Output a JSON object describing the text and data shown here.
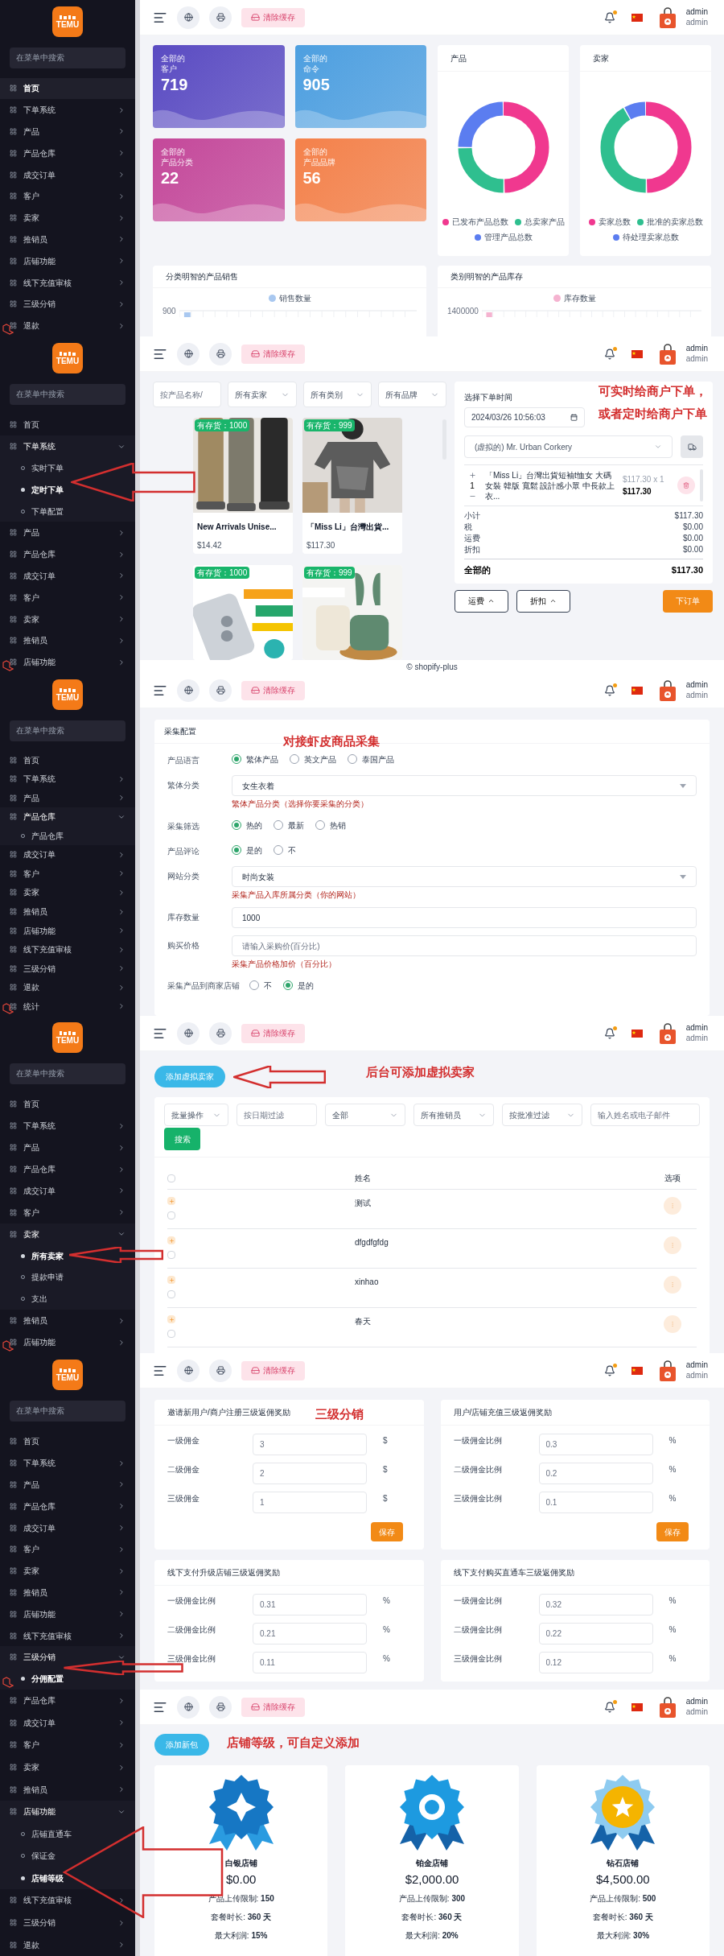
{
  "panels": [
    {
      "kind": "dashboard",
      "sidebar": {
        "logo": "TEMU",
        "search_placeholder": "在菜单中搜索",
        "items": [
          {
            "label": "首页",
            "selected": true
          },
          {
            "label": "下单系统",
            "selected": false,
            "expanded": false
          },
          {
            "label": "产品",
            "selected": false,
            "expanded": false
          },
          {
            "label": "产品仓库",
            "selected": false,
            "expanded": false
          },
          {
            "label": "成交订单",
            "selected": false,
            "expanded": false
          },
          {
            "label": "客户",
            "selected": false,
            "expanded": false
          },
          {
            "label": "卖家",
            "selected": false,
            "expanded": false
          },
          {
            "label": "推销员",
            "selected": false,
            "expanded": false
          },
          {
            "label": "店铺功能",
            "selected": false,
            "expanded": false
          },
          {
            "label": "线下充值审核",
            "selected": false,
            "expanded": false
          },
          {
            "label": "三级分销",
            "selected": false,
            "expanded": false
          },
          {
            "label": "退款",
            "selected": false,
            "expanded": false
          }
        ]
      },
      "header": {
        "clear_cache": "清除缓存",
        "unread": true,
        "user": "admin",
        "role": "admin"
      },
      "stats": [
        {
          "label": "全部的",
          "sublabel": "客户",
          "value": "719",
          "color": "#5a4bc2"
        },
        {
          "label": "全部的",
          "sublabel": "命令",
          "value": "905",
          "color": "#4d9fe0"
        },
        {
          "label": "全部的",
          "sublabel": "产品分类",
          "value": "22",
          "color": "#c4489a"
        },
        {
          "label": "全部的",
          "sublabel": "产品品牌",
          "value": "56",
          "color": "#f4814a"
        }
      ],
      "donuts": [
        {
          "title": "产品",
          "legend": [
            {
              "label": "已发布产品总数",
              "color": "#f0388f"
            },
            {
              "label": "总卖家产品",
              "color": "#2fbf8f"
            },
            {
              "label": "管理产品总数",
              "color": "#5b7df0"
            }
          ]
        },
        {
          "title": "卖家",
          "legend": [
            {
              "label": "卖家总数",
              "color": "#f0388f"
            },
            {
              "label": "批准的卖家总数",
              "color": "#2fbf8f"
            },
            {
              "label": "待处理卖家总数",
              "color": "#5b7df0"
            }
          ]
        }
      ],
      "bar_charts": [
        {
          "title": "分类明智的产品销售",
          "legend": {
            "label": "销售数量",
            "color": "#a9c8f0"
          },
          "y_tick": "900"
        },
        {
          "title": "类别明智的产品库存",
          "legend": {
            "label": "库存数量",
            "color": "#f5b3d0"
          },
          "y_tick": "1400000"
        }
      ]
    },
    {
      "kind": "order",
      "sidebar": {
        "logo": "TEMU",
        "search_placeholder": "在菜单中搜索",
        "items": [
          {
            "label": "首页",
            "selected": false
          },
          {
            "label": "下单系统",
            "selected": false,
            "expanded": true,
            "children": [
              {
                "label": "实时下单",
                "selected": false
              },
              {
                "label": "定时下单",
                "selected": true
              },
              {
                "label": "下单配置",
                "selected": false
              }
            ]
          },
          {
            "label": "产品",
            "selected": false,
            "expanded": false
          },
          {
            "label": "产品仓库",
            "selected": false,
            "expanded": false
          },
          {
            "label": "成交订单",
            "selected": false,
            "expanded": false
          },
          {
            "label": "客户",
            "selected": false,
            "expanded": false
          },
          {
            "label": "卖家",
            "selected": false,
            "expanded": false
          },
          {
            "label": "推销员",
            "selected": false,
            "expanded": false
          },
          {
            "label": "店铺功能",
            "selected": false,
            "expanded": false
          }
        ]
      },
      "header": {
        "clear_cache": "清除缓存",
        "unread": true,
        "user": "admin",
        "role": "admin"
      },
      "annotations": [
        "可实时给商户下单，",
        "或者定时给商户下单"
      ],
      "filters": [
        {
          "kind": "input",
          "placeholder": "按产品名称/"
        },
        {
          "kind": "select",
          "value": "所有卖家"
        },
        {
          "kind": "select",
          "value": "所有类别"
        },
        {
          "kind": "select",
          "value": "所有品牌"
        }
      ],
      "products": [
        {
          "stock": "有存货：1000",
          "name": "New Arrivals Unise...",
          "price": "$14.42"
        },
        {
          "stock": "有存货：999",
          "name": "「Miss Li」台灣出貨...",
          "price": "$117.30"
        },
        {
          "stock": "有存货：1000"
        },
        {
          "stock": "有存货：999"
        }
      ],
      "order": {
        "time_label": "选择下单时间",
        "time": "2024/03/26 10:56:03",
        "customer": "(虚拟的) Mr. Urban Corkery",
        "cart": [
          {
            "qty": "1",
            "name": "「Miss Li」台灣出貨短袖t恤女 大碼女裝 韓版 寬鬆 設計感小眾 中長款上衣...",
            "unit": "$117.30 x 1",
            "price": "$117.30"
          }
        ],
        "summary": [
          {
            "label": "小计",
            "value": "$117.30"
          },
          {
            "label": "税",
            "value": "$0.00"
          },
          {
            "label": "运费",
            "value": "$0.00"
          },
          {
            "label": "折扣",
            "value": "$0.00"
          }
        ],
        "total": {
          "label": "全部的",
          "value": "$117.30"
        }
      },
      "buttons": [
        {
          "kind": "toggle",
          "label": "运费"
        },
        {
          "kind": "toggle",
          "label": "折扣"
        },
        {
          "kind": "primary",
          "label": "下订单"
        }
      ],
      "footer": "© shopify-plus"
    },
    {
      "kind": "collect_form",
      "sidebar": {
        "logo": "TEMU",
        "search_placeholder": "在菜单中搜索",
        "items": [
          {
            "label": "首页",
            "selected": false
          },
          {
            "label": "下单系统",
            "selected": false,
            "expanded": false
          },
          {
            "label": "产品",
            "selected": false,
            "expanded": false
          },
          {
            "label": "产品仓库",
            "selected": false,
            "expanded": true,
            "children": [
              {
                "label": "产品仓库",
                "selected": false
              }
            ]
          },
          {
            "label": "成交订单",
            "selected": false,
            "expanded": false
          },
          {
            "label": "客户",
            "selected": false,
            "expanded": false
          },
          {
            "label": "卖家",
            "selected": false,
            "expanded": false
          },
          {
            "label": "推销员",
            "selected": false,
            "expanded": false
          },
          {
            "label": "店铺功能",
            "selected": false,
            "expanded": false
          },
          {
            "label": "线下充值审核",
            "selected": false,
            "expanded": false
          },
          {
            "label": "三级分销",
            "selected": false,
            "expanded": false
          },
          {
            "label": "退款",
            "selected": false,
            "expanded": false
          },
          {
            "label": "统计",
            "selected": false,
            "expanded": false
          }
        ]
      },
      "header": {
        "clear_cache": "清除缓存",
        "unread": true,
        "user": "admin",
        "role": "admin"
      },
      "annotations": [
        "对接虾皮商品采集"
      ],
      "card_title": "采集配置",
      "rows": [
        {
          "kind": "radio",
          "label": "产品语言",
          "options": [
            {
              "label": "繁体产品",
              "selected": true
            },
            {
              "label": "英文产品",
              "selected": false
            },
            {
              "label": "泰国产品",
              "selected": false
            }
          ]
        },
        {
          "kind": "select",
          "label": "繁体分类",
          "value": "女生衣着",
          "hint": "繁体产品分类（选择你要采集的分类）"
        },
        {
          "kind": "radio",
          "label": "采集筛选",
          "options": [
            {
              "label": "热的",
              "selected": true
            },
            {
              "label": "最新",
              "selected": false
            },
            {
              "label": "热销",
              "selected": false
            }
          ]
        },
        {
          "kind": "radio",
          "label": "产品评论",
          "options": [
            {
              "label": "是的",
              "selected": true
            },
            {
              "label": "不",
              "selected": false
            }
          ]
        },
        {
          "kind": "select",
          "label": "网站分类",
          "value": "时尚女装",
          "hint": "采集产品入库所属分类（你的网站）"
        },
        {
          "kind": "input",
          "label": "库存数量",
          "value": "1000"
        },
        {
          "kind": "input",
          "label": "购买价格",
          "placeholder": "请输入采购价(百分比)",
          "hint": "采集产品价格加价（百分比）"
        },
        {
          "kind": "radio",
          "label": "采集产品到商家店铺",
          "options": [
            {
              "label": "不",
              "selected": false
            },
            {
              "label": "是的",
              "selected": true
            }
          ]
        }
      ]
    },
    {
      "kind": "sellers",
      "sidebar": {
        "logo": "TEMU",
        "search_placeholder": "在菜单中搜索",
        "items": [
          {
            "label": "首页",
            "selected": false
          },
          {
            "label": "下单系统",
            "selected": false,
            "expanded": false
          },
          {
            "label": "产品",
            "selected": false,
            "expanded": false
          },
          {
            "label": "产品仓库",
            "selected": false,
            "expanded": false
          },
          {
            "label": "成交订单",
            "selected": false,
            "expanded": false
          },
          {
            "label": "客户",
            "selected": false,
            "expanded": false
          },
          {
            "label": "卖家",
            "selected": false,
            "expanded": true,
            "children": [
              {
                "label": "所有卖家",
                "selected": true
              },
              {
                "label": "提款申请",
                "selected": false
              },
              {
                "label": "支出",
                "selected": false
              }
            ]
          },
          {
            "label": "推销员",
            "selected": false,
            "expanded": false
          },
          {
            "label": "店铺功能",
            "selected": false,
            "expanded": false
          }
        ]
      },
      "header": {
        "clear_cache": "清除缓存",
        "unread": true,
        "user": "admin",
        "role": "admin"
      },
      "annotations": [
        "后台可添加虚拟卖家"
      ],
      "add_button": "添加虚拟卖家",
      "filters": [
        {
          "kind": "select",
          "value": "批量操作"
        },
        {
          "kind": "input",
          "placeholder": "按日期过滤"
        },
        {
          "kind": "select",
          "value": "全部"
        },
        {
          "kind": "select",
          "value": "所有推销员"
        },
        {
          "kind": "select",
          "value": "按批准过滤"
        },
        {
          "kind": "input",
          "placeholder": "输入姓名或电子邮件"
        }
      ],
      "search_button": "搜索",
      "all_checked": false,
      "columns": [
        "姓名",
        "选项"
      ],
      "rows": [
        {
          "name": "测试",
          "checked": false
        },
        {
          "name": "dfgdfgfdg",
          "checked": false
        },
        {
          "name": "xinhao",
          "checked": false
        },
        {
          "name": "春天",
          "checked": false
        }
      ]
    },
    {
      "kind": "commission",
      "sidebar": {
        "logo": "TEMU",
        "search_placeholder": "在菜单中搜索",
        "items": [
          {
            "label": "首页",
            "selected": false
          },
          {
            "label": "下单系统",
            "selected": false,
            "expanded": false
          },
          {
            "label": "产品",
            "selected": false,
            "expanded": false
          },
          {
            "label": "产品仓库",
            "selected": false,
            "expanded": false
          },
          {
            "label": "成交订单",
            "selected": false,
            "expanded": false
          },
          {
            "label": "客户",
            "selected": false,
            "expanded": false
          },
          {
            "label": "卖家",
            "selected": false,
            "expanded": false
          },
          {
            "label": "推销员",
            "selected": false,
            "expanded": false
          },
          {
            "label": "店铺功能",
            "selected": false,
            "expanded": false
          },
          {
            "label": "线下充值审核",
            "selected": false,
            "expanded": false
          },
          {
            "label": "三级分销",
            "selected": false,
            "expanded": true,
            "children": [
              {
                "label": "分佣配置",
                "selected": true
              }
            ]
          }
        ]
      },
      "header": {
        "clear_cache": "清除缓存",
        "unread": true,
        "user": "admin",
        "role": "admin"
      },
      "annotations": [
        "三级分销"
      ],
      "cards": [
        {
          "title": "邀请新用户/商户注册三级返佣奖励",
          "fields": [
            {
              "label": "一级佣金",
              "value": "3",
              "unit": "$"
            },
            {
              "label": "二级佣金",
              "value": "2",
              "unit": "$"
            },
            {
              "label": "三级佣金",
              "value": "1",
              "unit": "$"
            }
          ],
          "save": "保存"
        },
        {
          "title": "用户/店铺充值三级返佣奖励",
          "fields": [
            {
              "label": "一级佣金比例",
              "value": "0.3",
              "unit": "%"
            },
            {
              "label": "二级佣金比例",
              "value": "0.2",
              "unit": "%"
            },
            {
              "label": "三级佣金比例",
              "value": "0.1",
              "unit": "%"
            }
          ],
          "save": "保存"
        },
        {
          "title": "线下支付升级店铺三级返佣奖励",
          "fields": [
            {
              "label": "一级佣金比例",
              "value": "0.31",
              "unit": "%"
            },
            {
              "label": "二级佣金比例",
              "value": "0.21",
              "unit": "%"
            },
            {
              "label": "三级佣金比例",
              "value": "0.11",
              "unit": "%"
            }
          ]
        },
        {
          "title": "线下支付购买直通车三级返佣奖励",
          "fields": [
            {
              "label": "一级佣金比例",
              "value": "0.32",
              "unit": "%"
            },
            {
              "label": "二级佣金比例",
              "value": "0.22",
              "unit": "%"
            },
            {
              "label": "三级佣金比例",
              "value": "0.12",
              "unit": "%"
            }
          ]
        }
      ]
    },
    {
      "kind": "levels",
      "sidebar": {
        "items": [
          {
            "label": "产品仓库",
            "selected": false,
            "expanded": false
          },
          {
            "label": "成交订单",
            "selected": false,
            "expanded": false
          },
          {
            "label": "客户",
            "selected": false,
            "expanded": false
          },
          {
            "label": "卖家",
            "selected": false,
            "expanded": false
          },
          {
            "label": "推销员",
            "selected": false,
            "expanded": false
          },
          {
            "label": "店铺功能",
            "selected": false,
            "expanded": true,
            "children": [
              {
                "label": "店铺直通车",
                "selected": false
              },
              {
                "label": "保证金",
                "selected": false
              },
              {
                "label": "店铺等级",
                "selected": true
              }
            ]
          },
          {
            "label": "线下充值审核",
            "selected": false,
            "expanded": false
          },
          {
            "label": "三级分销",
            "selected": false,
            "expanded": false
          },
          {
            "label": "退款",
            "selected": false,
            "expanded": false
          }
        ]
      },
      "header": {
        "clear_cache": "清除缓存",
        "unread": true,
        "user": "admin",
        "role": "admin"
      },
      "annotations": [
        "店铺等级，可自定义添加"
      ],
      "add_button": "添加新包",
      "levels": [
        {
          "name": "白银店铺",
          "price": "$0.00",
          "lines": [
            "产品上传限制: **150**",
            "套餐时长: **360 天**",
            "最大利润: **15%**"
          ]
        },
        {
          "name": "铂金店铺",
          "price": "$2,000.00",
          "lines": [
            "产品上传限制: **300**",
            "套餐时长: **360 天**",
            "最大利润: **20%**"
          ]
        },
        {
          "name": "钻石店铺",
          "price": "$4,500.00",
          "lines": [
            "产品上传限制: **500**",
            "套餐时长: **360 天**",
            "最大利润: **30%**"
          ]
        }
      ]
    }
  ]
}
